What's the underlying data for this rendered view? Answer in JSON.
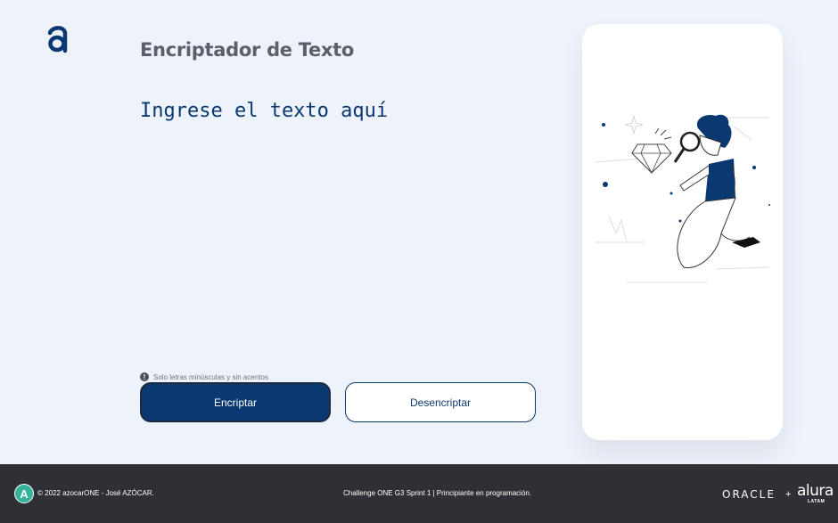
{
  "header": {
    "title": "Encriptador de Texto"
  },
  "input": {
    "placeholder": "Ingrese el texto aquí"
  },
  "hint": {
    "text": "Solo letras minúsculas y sin acentos"
  },
  "actions": {
    "encrypt_label": "Encriptar",
    "decrypt_label": "Desencriptar"
  },
  "footer": {
    "logo_letter": "A",
    "copyright": "© 2022 azocarONE - José AZÓCAR.",
    "challenge": "Challenge ONE G3 Sprint 1 | Principiante en programación.",
    "oracle": "ORACLE",
    "plus": "+",
    "alura": "alura",
    "latam": "LATAM"
  },
  "colors": {
    "primary": "#0a3871",
    "background": "#eef2fb",
    "footer": "#2e3035",
    "title": "#5b5f68"
  }
}
